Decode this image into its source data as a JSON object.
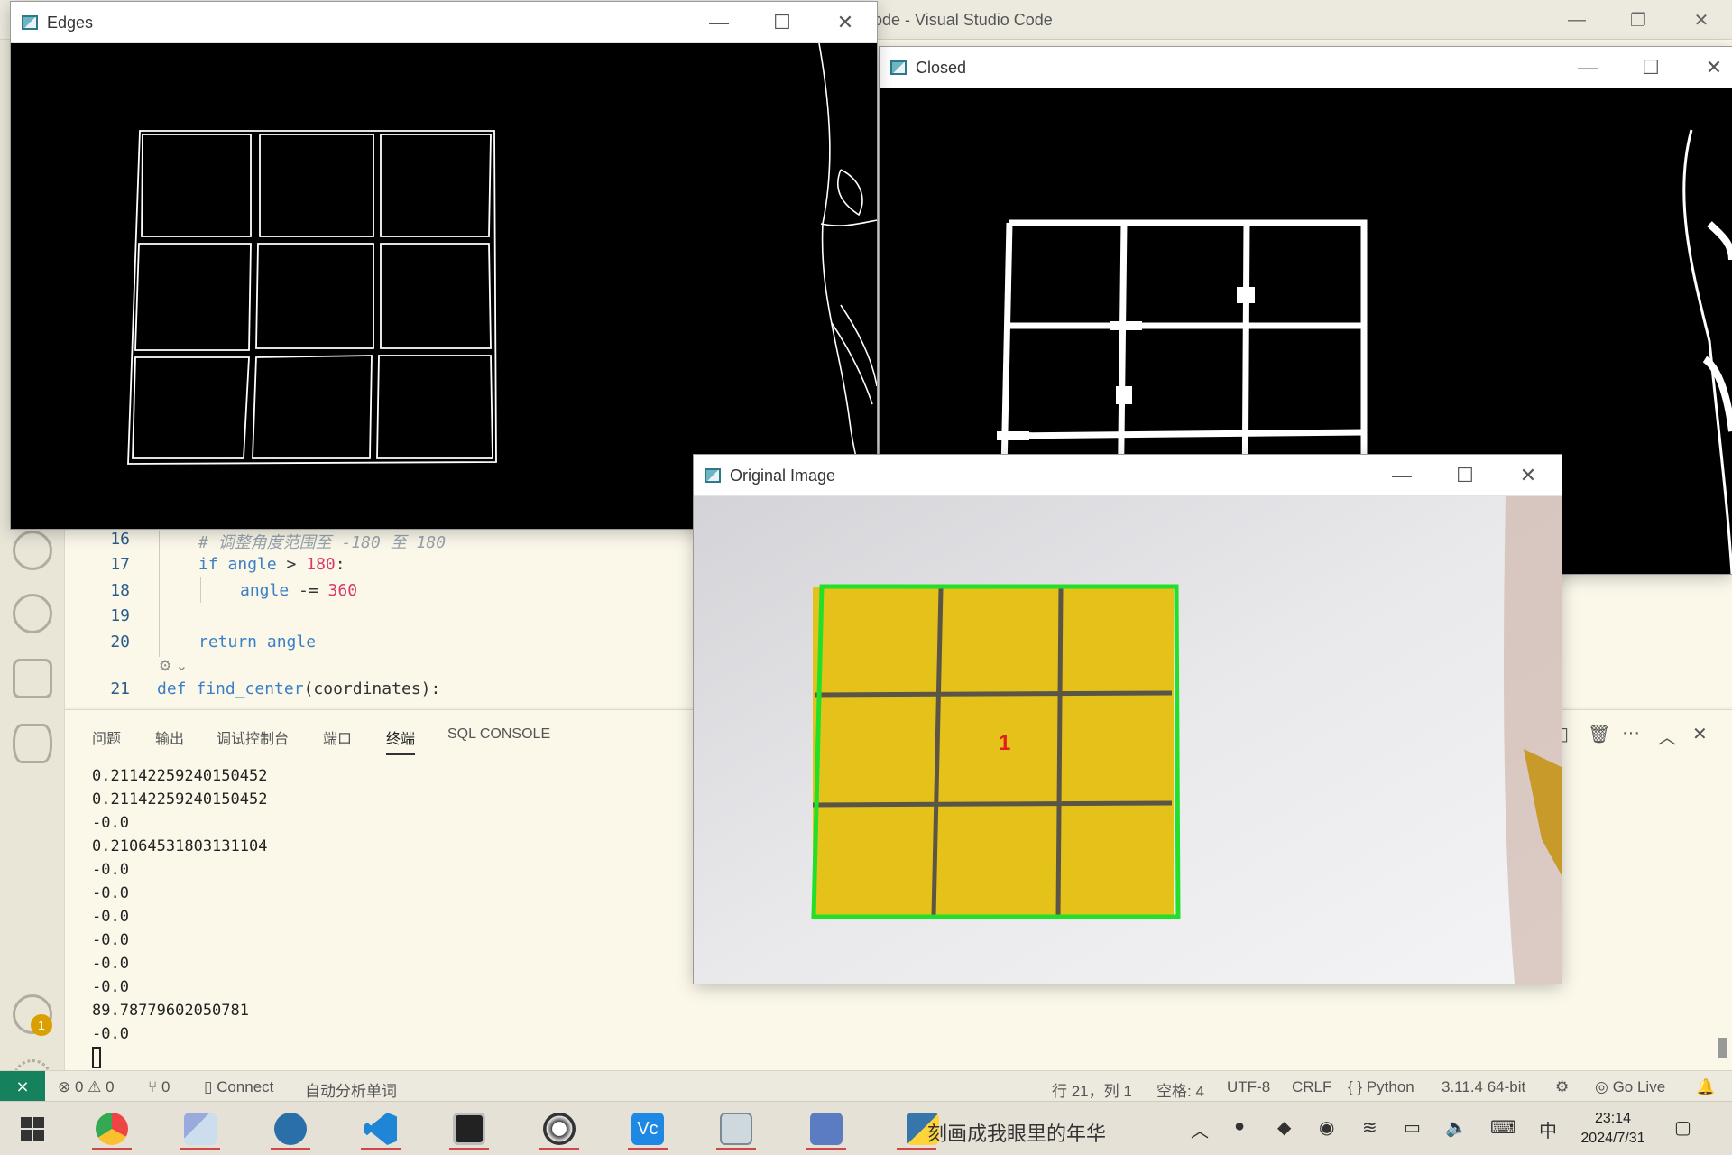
{
  "vscode": {
    "title_fragment": "ode - Visual Studio Code",
    "editor": {
      "lines": [
        {
          "num": "16",
          "comment": "# 调整角度范围至 -180 至 180"
        },
        {
          "num": "17",
          "kw": "if",
          "var": "angle",
          "op": " > ",
          "val": "180",
          "tail": ":"
        },
        {
          "num": "18",
          "var": "angle",
          "op": " -= ",
          "val": "360"
        },
        {
          "num": "19"
        },
        {
          "num": "20",
          "kw": "return",
          "var": "angle"
        },
        {
          "num": "21",
          "kw": "def",
          "fn": "find_center",
          "args": "(coordinates):"
        }
      ]
    },
    "panel": {
      "tabs": [
        "问题",
        "输出",
        "调试控制台",
        "端口",
        "终端",
        "SQL CONSOLE"
      ],
      "active_tab": "终端"
    },
    "terminal_lines": [
      "0.21142259240150452",
      "0.21142259240150452",
      "-0.0",
      "0.21064531803131104",
      "-0.0",
      "-0.0",
      "-0.0",
      "-0.0",
      "-0.0",
      "-0.0",
      "89.78779602050781",
      "-0.0"
    ],
    "status": {
      "errors": "0",
      "warnings": "0",
      "ports": "0",
      "connect": "Connect",
      "auto": "自动分析单词",
      "position": "行 21，列 1",
      "spaces": "空格: 4",
      "encoding": "UTF-8",
      "eol": "CRLF",
      "language": "Python",
      "interpreter": "3.11.4 64-bit",
      "golive": "Go Live"
    },
    "account_badge": "1"
  },
  "windows": {
    "edges": {
      "title": "Edges"
    },
    "closed": {
      "title": "Closed"
    },
    "original": {
      "title": "Original Image",
      "cell_label": "1"
    }
  },
  "taskbar": {
    "active_title": "刻画成我眼里的年华",
    "time": "23:14",
    "date": "2024/7/31",
    "ime": "中"
  }
}
